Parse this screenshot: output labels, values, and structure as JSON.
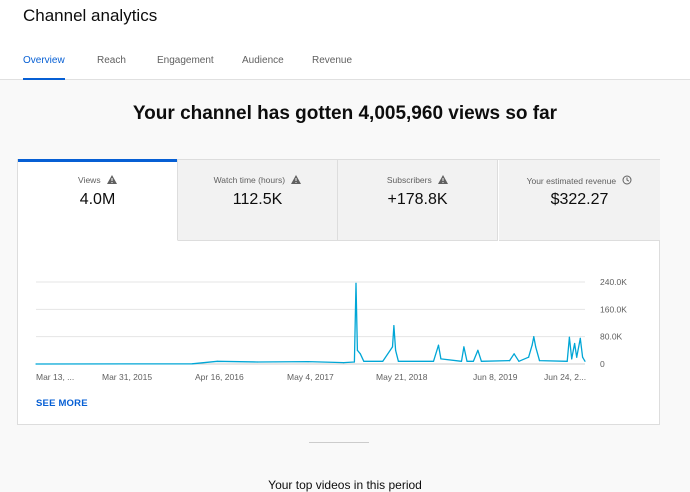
{
  "header": {
    "title": "Channel analytics",
    "tabs": [
      {
        "label": "Overview",
        "active": true
      },
      {
        "label": "Reach",
        "active": false
      },
      {
        "label": "Engagement",
        "active": false
      },
      {
        "label": "Audience",
        "active": false
      },
      {
        "label": "Revenue",
        "active": false
      }
    ]
  },
  "headline": "Your channel has gotten 4,005,960 views so far",
  "stats": [
    {
      "label": "Views",
      "value": "4.0M",
      "icon": "warning-icon"
    },
    {
      "label": "Watch time (hours)",
      "value": "112.5K",
      "icon": "warning-icon"
    },
    {
      "label": "Subscribers",
      "value": "+178.8K",
      "icon": "warning-icon"
    },
    {
      "label": "Your estimated revenue",
      "value": "$322.27",
      "icon": "clock-icon"
    }
  ],
  "see_more": "SEE MORE",
  "bottom_text": "Your top videos in this period",
  "colors": {
    "accent": "#065fd4",
    "line": "#00a6d6"
  },
  "chart_data": {
    "type": "line",
    "x_ticks": [
      "Mar 13, ...",
      "Mar 31, 2015",
      "Apr 16, 2016",
      "May 4, 2017",
      "May 21, 2018",
      "Jun 8, 2019",
      "Jun 24, 2..."
    ],
    "y_ticks": [
      "240.0K",
      "160.0K",
      "80.0K",
      "0"
    ],
    "ylim": [
      0,
      240000
    ],
    "x_range": [
      "2014-03-13",
      "2020-07-15"
    ],
    "series": [
      {
        "points": [
          [
            "2014-03-13",
            0
          ],
          [
            "2016-01-01",
            500
          ],
          [
            "2016-04-16",
            8000
          ],
          [
            "2016-10-01",
            6000
          ],
          [
            "2017-05-04",
            7000
          ],
          [
            "2017-10-01",
            4000
          ],
          [
            "2017-11-15",
            6000
          ],
          [
            "2017-11-22",
            236000
          ],
          [
            "2017-11-28",
            40000
          ],
          [
            "2017-12-10",
            30000
          ],
          [
            "2017-12-25",
            8000
          ],
          [
            "2018-03-15",
            8000
          ],
          [
            "2018-04-25",
            50000
          ],
          [
            "2018-05-01",
            112000
          ],
          [
            "2018-05-08",
            40000
          ],
          [
            "2018-05-20",
            8000
          ],
          [
            "2018-10-15",
            8000
          ],
          [
            "2018-11-05",
            55000
          ],
          [
            "2018-11-15",
            15000
          ],
          [
            "2019-02-10",
            8000
          ],
          [
            "2019-02-20",
            50000
          ],
          [
            "2019-03-05",
            8000
          ],
          [
            "2019-04-01",
            8000
          ],
          [
            "2019-04-20",
            40000
          ],
          [
            "2019-05-05",
            8000
          ],
          [
            "2019-09-01",
            10000
          ],
          [
            "2019-09-20",
            30000
          ],
          [
            "2019-10-10",
            8000
          ],
          [
            "2019-11-20",
            20000
          ],
          [
            "2019-12-05",
            55000
          ],
          [
            "2019-12-12",
            80000
          ],
          [
            "2019-12-20",
            50000
          ],
          [
            "2020-01-05",
            10000
          ],
          [
            "2020-05-01",
            8000
          ],
          [
            "2020-05-10",
            78000
          ],
          [
            "2020-05-20",
            15000
          ],
          [
            "2020-06-01",
            60000
          ],
          [
            "2020-06-10",
            20000
          ],
          [
            "2020-06-25",
            75000
          ],
          [
            "2020-07-05",
            20000
          ],
          [
            "2020-07-15",
            8000
          ]
        ]
      }
    ]
  }
}
